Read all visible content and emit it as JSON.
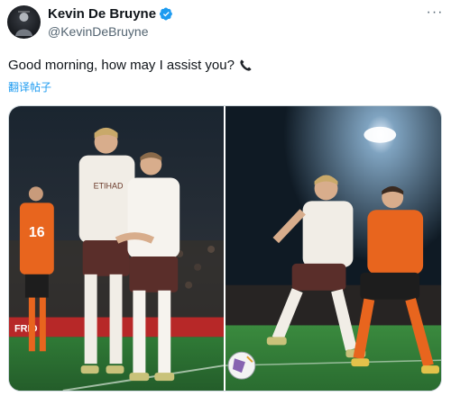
{
  "author": {
    "display_name": "Kevin De Bruyne",
    "handle": "@KevinDeBruyne",
    "verified_icon": "verified-badge-icon",
    "avatar_icon": "avatar"
  },
  "menu": {
    "more_icon": "more-dots-icon",
    "more_glyph": "···"
  },
  "tweet": {
    "text": "Good morning, how may I assist you?",
    "emoji_icon": "telephone-receiver-icon"
  },
  "translate_label": "翻译帖子",
  "media": {
    "photos": [
      {
        "kind": "two players celebrating on pitch",
        "shirt_number": "16",
        "board_text": "FRID"
      },
      {
        "kind": "player dribbling ball under floodlight"
      }
    ]
  },
  "colors": {
    "accent": "#1d9bf0",
    "text": "#0f1419",
    "secondary": "#536471",
    "kit_white": "#f1ede6",
    "kit_maroon": "#5a2e2a",
    "opponent_orange": "#e8651e",
    "pitch_green": "#2f7a36"
  }
}
